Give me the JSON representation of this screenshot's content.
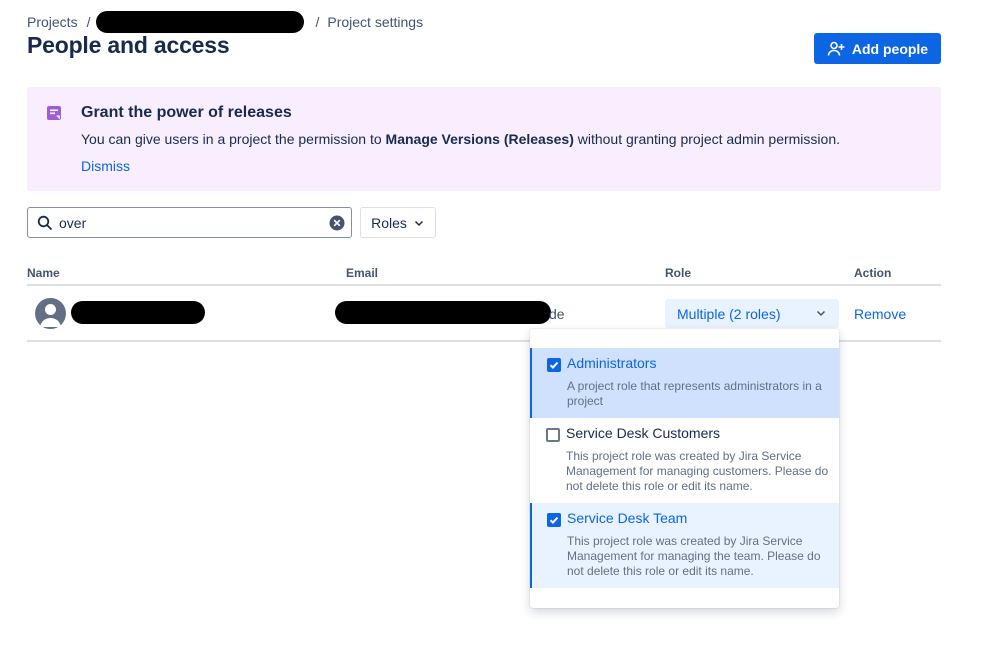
{
  "breadcrumb": {
    "projects": "Projects",
    "separator": "/",
    "current": "Project settings"
  },
  "page": {
    "title": "People and access"
  },
  "add_people_button": {
    "label": "Add people",
    "icon": "add-person-icon"
  },
  "banner": {
    "icon": "release-note-icon",
    "title": "Grant the power of releases",
    "text_before": "You can give users in a project the permission to ",
    "text_bold": "Manage Versions (Releases)",
    "text_after": " without granting project admin permission.",
    "dismiss": "Dismiss"
  },
  "search": {
    "value": "over",
    "icon": "search-icon",
    "clear_icon": "clear-icon"
  },
  "roles_filter": {
    "label": "Roles"
  },
  "table": {
    "columns": [
      "Name",
      "Email",
      "Role",
      "Action"
    ],
    "rows": [
      {
        "email_suffix": "de",
        "role": "Multiple (2 roles)",
        "action": "Remove"
      }
    ]
  },
  "role_menu": {
    "options": [
      {
        "title": "Administrators",
        "description": "A project role that represents administrators in a project",
        "checked": true
      },
      {
        "title": "Service Desk Customers",
        "description": "This project role was created by Jira Service Management for managing customers. Please do not delete this role or edit its name.",
        "checked": false
      },
      {
        "title": "Service Desk Team",
        "description": "This project role was created by Jira Service Management for managing the team. Please do not delete this role or edit its name.",
        "checked": true
      }
    ]
  },
  "colors": {
    "brand": "#0c66e4",
    "banner_bg": "#f8eefe",
    "banner_icon": "#9f5ed6",
    "selected_bg": "#e9f2ff"
  }
}
